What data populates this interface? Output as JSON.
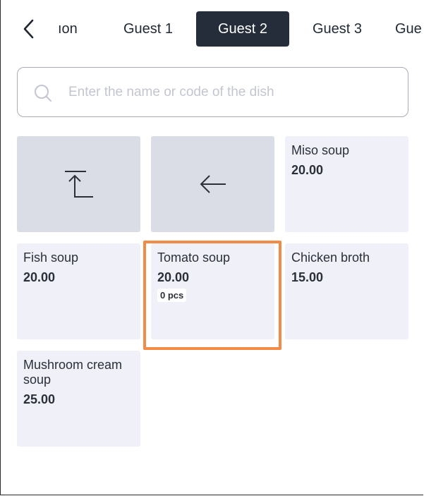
{
  "tabs": [
    {
      "label": "ıon",
      "active": false
    },
    {
      "label": "Guest 1",
      "active": false
    },
    {
      "label": "Guest 2",
      "active": true
    },
    {
      "label": "Guest 3",
      "active": false
    },
    {
      "label": "Gue",
      "active": false
    }
  ],
  "search": {
    "placeholder": "Enter the name or code of the dish",
    "value": ""
  },
  "dishes": [
    {
      "name": "Miso soup",
      "price": "20.00"
    },
    {
      "name": "Fish soup",
      "price": "20.00"
    },
    {
      "name": "Tomato soup",
      "price": "20.00",
      "qty": "0 pcs"
    },
    {
      "name": "Chicken broth",
      "price": "15.00"
    },
    {
      "name": "Mushroom cream soup",
      "price": "25.00"
    }
  ],
  "icons": {
    "back": "chevron-left-icon",
    "search": "search-icon",
    "top": "arrow-up-to-top-icon",
    "prev": "arrow-left-icon"
  },
  "colors": {
    "active_tab": "#262d3a",
    "tile_bg": "#f0f0f9",
    "nav_tile_bg": "#dadce6",
    "highlight": "#f28a48"
  }
}
